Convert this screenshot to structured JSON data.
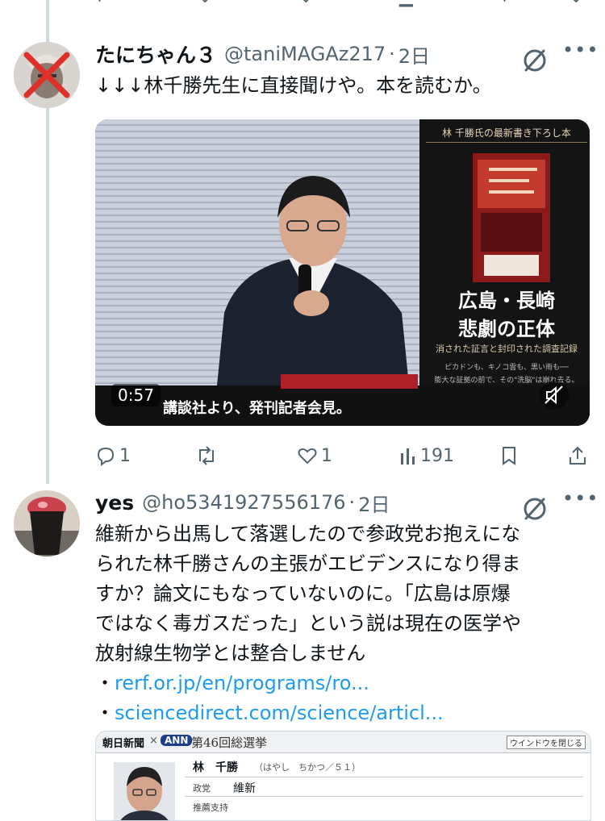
{
  "tweets": [
    {
      "name": "たにちゃん３",
      "handle": "@taniMAGAz217",
      "sep": "·",
      "time": "2日",
      "text_lines": [
        "↓↓↓林千勝先生に直接聞けや。本を読むか。"
      ],
      "video": {
        "duration": "0:57",
        "caption": "講談社より、発刊記者会見。",
        "book_header": "林 千勝氏の最新書き下ろし本",
        "book_title_1": "広島・長崎",
        "book_title_2": "悲劇の正体",
        "book_subtitle": "消された証言と封印された調査記録",
        "book_blurb_1": "ピカドンも、キノコ雲も、黒い雨も──",
        "book_blurb_2": "膨大な証拠の前で、その\"洗脳\"は崩れ去る。"
      },
      "actions": {
        "reply": "1",
        "retweet": "",
        "like": "1",
        "views": "191"
      }
    },
    {
      "name": "yes",
      "handle": "@ho5341927556176",
      "sep": "·",
      "time": "2日",
      "text_lines": [
        "維新から出馬して落選したので参政党お抱えにな",
        "られた林千勝さんの主張がエビデンスになり得ま",
        "すか？論文にもなっていないのに。「広島は原爆",
        "ではなく毒ガスだった」という説は現在の医学や",
        "放射線生物学とは整合しません"
      ],
      "links": [
        {
          "bullet": "・",
          "text": "rerf.or.jp/en/programs/ro..."
        },
        {
          "bullet": "・",
          "text": "sciencedirect.com/science/articl..."
        }
      ],
      "embed": {
        "brand": "朝日新聞",
        "times": "×",
        "network": "ANN",
        "election": "第46回総選挙",
        "window_btn": "ウインドウを閉じる",
        "person_name": "林　千勝",
        "person_reading": "（はやし　ちかつ／５１）",
        "row1_label": "政党",
        "row1_value": "維新",
        "row2_label": "推薦支持"
      }
    }
  ],
  "colors": {
    "link": "#1d9bf0",
    "secondary": "#536471",
    "thread": "#cfd9de"
  }
}
